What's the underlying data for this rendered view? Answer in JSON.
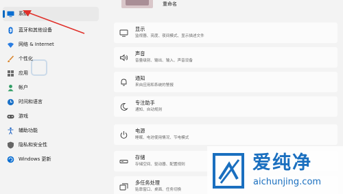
{
  "sidebar": {
    "items": [
      {
        "label": "系统",
        "icon": "monitor-icon",
        "active": true
      },
      {
        "label": "蓝牙和其他设备",
        "icon": "bluetooth-icon"
      },
      {
        "label": "网络 & Internet",
        "icon": "wifi-icon"
      },
      {
        "label": "个性化",
        "icon": "brush-icon"
      },
      {
        "label": "应用",
        "icon": "apps-icon"
      },
      {
        "label": "帐户",
        "icon": "person-icon"
      },
      {
        "label": "时间和语言",
        "icon": "globe-clock-icon"
      },
      {
        "label": "游戏",
        "icon": "gamepad-icon"
      },
      {
        "label": "辅助功能",
        "icon": "accessibility-icon"
      },
      {
        "label": "隐私和安全性",
        "icon": "shield-icon"
      },
      {
        "label": "Windows 更新",
        "icon": "update-icon"
      }
    ]
  },
  "header": {
    "rename_label": "重命名"
  },
  "main": {
    "cards": [
      {
        "title": "显示",
        "desc": "监视器、亮度、夜间模式、显示描述文件",
        "icon": "display-icon"
      },
      {
        "title": "声音",
        "desc": "音量级别、输出、输入、声音设备",
        "icon": "speaker-icon"
      },
      {
        "title": "通知",
        "desc": "来自应用和系统的警报",
        "icon": "bell-icon"
      },
      {
        "title": "专注助手",
        "desc": "通知、自动规则",
        "icon": "moon-icon"
      },
      {
        "title": "电源",
        "desc": "睡眠、电池使用情况、节电模式",
        "icon": "power-icon"
      },
      {
        "title": "存储",
        "desc": "存储空间、驱动器、配置规则",
        "icon": "storage-icon"
      },
      {
        "title": "多任务处理",
        "desc": "贴靠窗口、桌面、任务切换",
        "icon": "multitask-icon"
      }
    ]
  },
  "watermark": {
    "name": "爱纯净",
    "url": "aichunjing.com"
  },
  "colors": {
    "accent": "#0067c0",
    "arrow": "#e0302a",
    "watermark": "#1a6fbf"
  }
}
